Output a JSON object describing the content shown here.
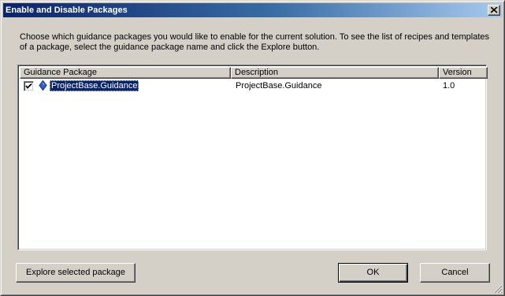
{
  "window": {
    "title": "Enable and Disable Packages"
  },
  "instructions": "Choose which guidance packages you would like to enable for the current solution. To see the list of recipes and templates of a package, select the guidance package name and click the Explore button.",
  "list": {
    "columns": {
      "package": "Guidance Package",
      "description": "Description",
      "version": "Version"
    },
    "rows": [
      {
        "checked": true,
        "icon": "package-diamond-icon",
        "name": "ProjectBase.Guidance",
        "description": "ProjectBase.Guidance",
        "version": "1.0",
        "selected": true
      }
    ]
  },
  "buttons": {
    "explore": "Explore selected package",
    "ok": "OK",
    "cancel": "Cancel"
  },
  "colors": {
    "title_gradient_start": "#0a246a",
    "title_gradient_end": "#a6caf0",
    "selection": "#0a246a",
    "face": "#d4d0c8"
  }
}
